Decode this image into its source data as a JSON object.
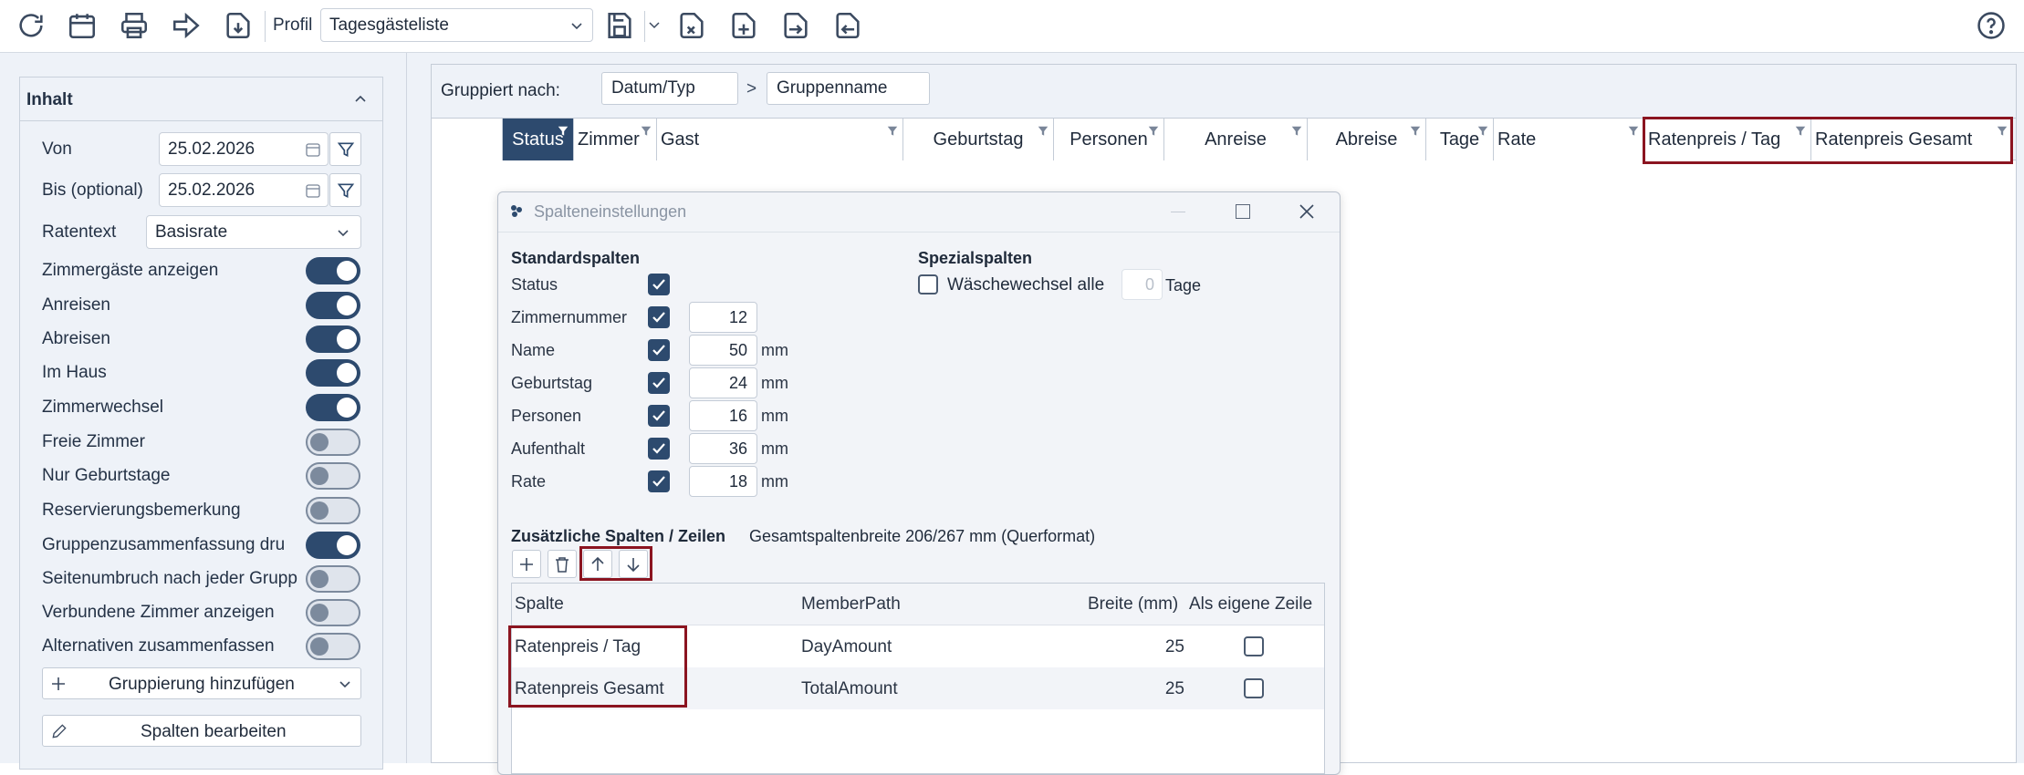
{
  "toolbar": {
    "profile_label": "Profil",
    "profile_value": "Tagesgästeliste"
  },
  "sidebar": {
    "section_title": "Inhalt",
    "von_label": "Von",
    "von_value": "25.02.2026",
    "bis_label": "Bis (optional)",
    "bis_value": "25.02.2026",
    "ratentext_label": "Ratentext",
    "ratentext_value": "Basisrate",
    "toggles": [
      {
        "label": "Zimmergäste anzeigen",
        "on": true
      },
      {
        "label": "Anreisen",
        "on": true
      },
      {
        "label": "Abreisen",
        "on": true
      },
      {
        "label": "Im Haus",
        "on": true
      },
      {
        "label": "Zimmerwechsel",
        "on": true
      },
      {
        "label": "Freie Zimmer",
        "on": false
      },
      {
        "label": "Nur Geburtstage",
        "on": false
      },
      {
        "label": "Reservierungsbemerkung",
        "on": false
      },
      {
        "label": "Gruppenzusammenfassung dru",
        "on": true
      },
      {
        "label": "Seitenumbruch nach jeder Grupp",
        "on": false
      },
      {
        "label": "Verbundene Zimmer anzeigen",
        "on": false
      },
      {
        "label": "Alternativen zusammenfassen",
        "on": false
      }
    ],
    "add_grouping": "Gruppierung hinzufügen",
    "edit_columns": "Spalten bearbeiten"
  },
  "grid": {
    "grouped_by_label": "Gruppiert nach:",
    "group_chips": [
      "Datum/Typ",
      "Gruppenname"
    ],
    "separator": ">",
    "columns": [
      "Status",
      "Zimmer",
      "Gast",
      "Geburtstag",
      "Personen",
      "Anreise",
      "Abreise",
      "Tage",
      "Rate",
      "Ratenpreis / Tag",
      "Ratenpreis Gesamt"
    ]
  },
  "dialog": {
    "title": "Spalteneinstellungen",
    "standard_title": "Standardspalten",
    "special_title": "Spezialspalten",
    "standard_rows": [
      {
        "label": "Status",
        "value": "",
        "unit": ""
      },
      {
        "label": "Zimmernummer",
        "value": "12",
        "unit": ""
      },
      {
        "label": "Name",
        "value": "50",
        "unit": "mm"
      },
      {
        "label": "Geburtstag",
        "value": "24",
        "unit": "mm"
      },
      {
        "label": "Personen",
        "value": "16",
        "unit": "mm"
      },
      {
        "label": "Aufenthalt",
        "value": "36",
        "unit": "mm"
      },
      {
        "label": "Rate",
        "value": "18",
        "unit": "mm"
      }
    ],
    "special": {
      "label": "Wäschewechsel alle",
      "value": "0",
      "unit": "Tage"
    },
    "extra_title": "Zusätzliche Spalten / Zeilen",
    "total_width": "Gesamtspaltenbreite 206/267 mm (Querformat)",
    "table_headers": [
      "Spalte",
      "MemberPath",
      "Breite (mm)",
      "Als eigene Zeile"
    ],
    "rows": [
      {
        "spalte": "Ratenpreis / Tag",
        "member": "DayAmount",
        "breite": "25"
      },
      {
        "spalte": "Ratenpreis Gesamt",
        "member": "TotalAmount",
        "breite": "25"
      }
    ]
  }
}
